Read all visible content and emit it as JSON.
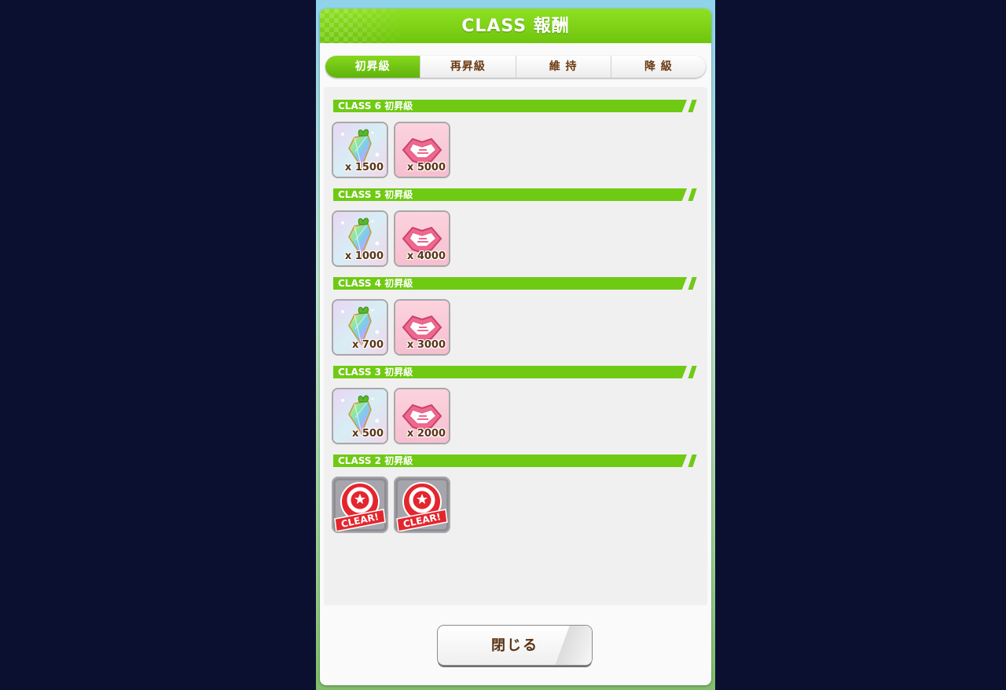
{
  "dialog": {
    "title": "CLASS 報酬",
    "close_label": "閉じる",
    "colors": {
      "accent": "#6fca14",
      "text_brown": "#5a3415",
      "outer_bg": "#0c1030"
    }
  },
  "tabs": [
    {
      "label": "初昇級",
      "active": true
    },
    {
      "label": "再昇級",
      "active": false
    },
    {
      "label": "維 持",
      "active": false
    },
    {
      "label": "降 級",
      "active": false
    }
  ],
  "sections": [
    {
      "label": "CLASS 6 初昇級",
      "items": [
        {
          "icon": "carat-gem-icon",
          "qty": "x 1500"
        },
        {
          "icon": "handshake-icon",
          "qty": "x 5000"
        }
      ]
    },
    {
      "label": "CLASS 5 初昇級",
      "items": [
        {
          "icon": "carat-gem-icon",
          "qty": "x 1000"
        },
        {
          "icon": "handshake-icon",
          "qty": "x 4000"
        }
      ]
    },
    {
      "label": "CLASS 4 初昇級",
      "items": [
        {
          "icon": "carat-gem-icon",
          "qty": "x 700"
        },
        {
          "icon": "handshake-icon",
          "qty": "x 3000"
        }
      ]
    },
    {
      "label": "CLASS 3 初昇級",
      "items": [
        {
          "icon": "carat-gem-icon",
          "qty": "x 500"
        },
        {
          "icon": "handshake-icon",
          "qty": "x 2000"
        }
      ]
    },
    {
      "label": "CLASS 2 初昇級",
      "items": [
        {
          "icon": "clear-stamp-icon",
          "stamp_text": "CLEAR!"
        },
        {
          "icon": "clear-stamp-icon",
          "stamp_text": "CLEAR!"
        }
      ]
    }
  ]
}
